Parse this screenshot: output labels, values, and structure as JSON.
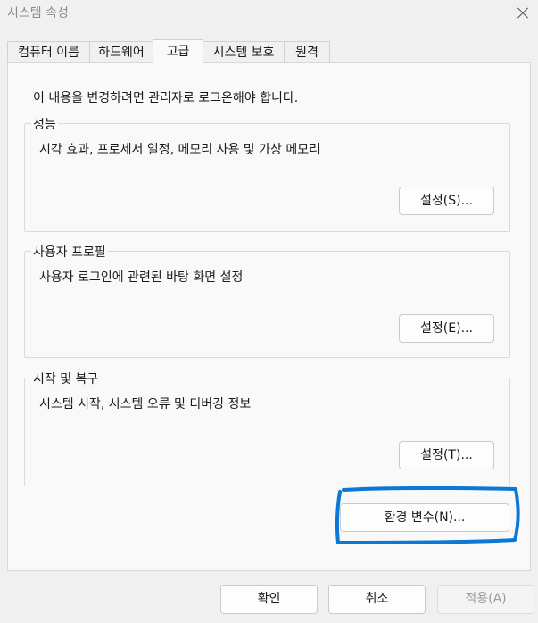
{
  "window": {
    "title": "시스템 속성"
  },
  "tabs": [
    {
      "label": "컴퓨터 이름"
    },
    {
      "label": "하드웨어"
    },
    {
      "label": "고급"
    },
    {
      "label": "시스템 보호"
    },
    {
      "label": "원격"
    }
  ],
  "active_tab": "고급",
  "notice": "이 내용을 변경하려면 관리자로 로그온해야 합니다.",
  "groups": [
    {
      "title": "성능",
      "description": "시각 효과, 프로세서 일정, 메모리 사용 및 가상 메모리",
      "button": "설정(S)..."
    },
    {
      "title": "사용자 프로필",
      "description": "사용자 로그인에 관련된 바탕 화면 설정",
      "button": "설정(E)..."
    },
    {
      "title": "시작 및 복구",
      "description": "시스템 시작, 시스템 오류 및 디버깅 정보",
      "button": "설정(T)..."
    }
  ],
  "env_button": "환경 변수(N)...",
  "footer": {
    "ok": "확인",
    "cancel": "취소",
    "apply": "적용(A)"
  },
  "colors": {
    "highlight": "#0a78d4",
    "window_bg": "#f0f0f0",
    "panel_bg": "#f9f9f9"
  }
}
